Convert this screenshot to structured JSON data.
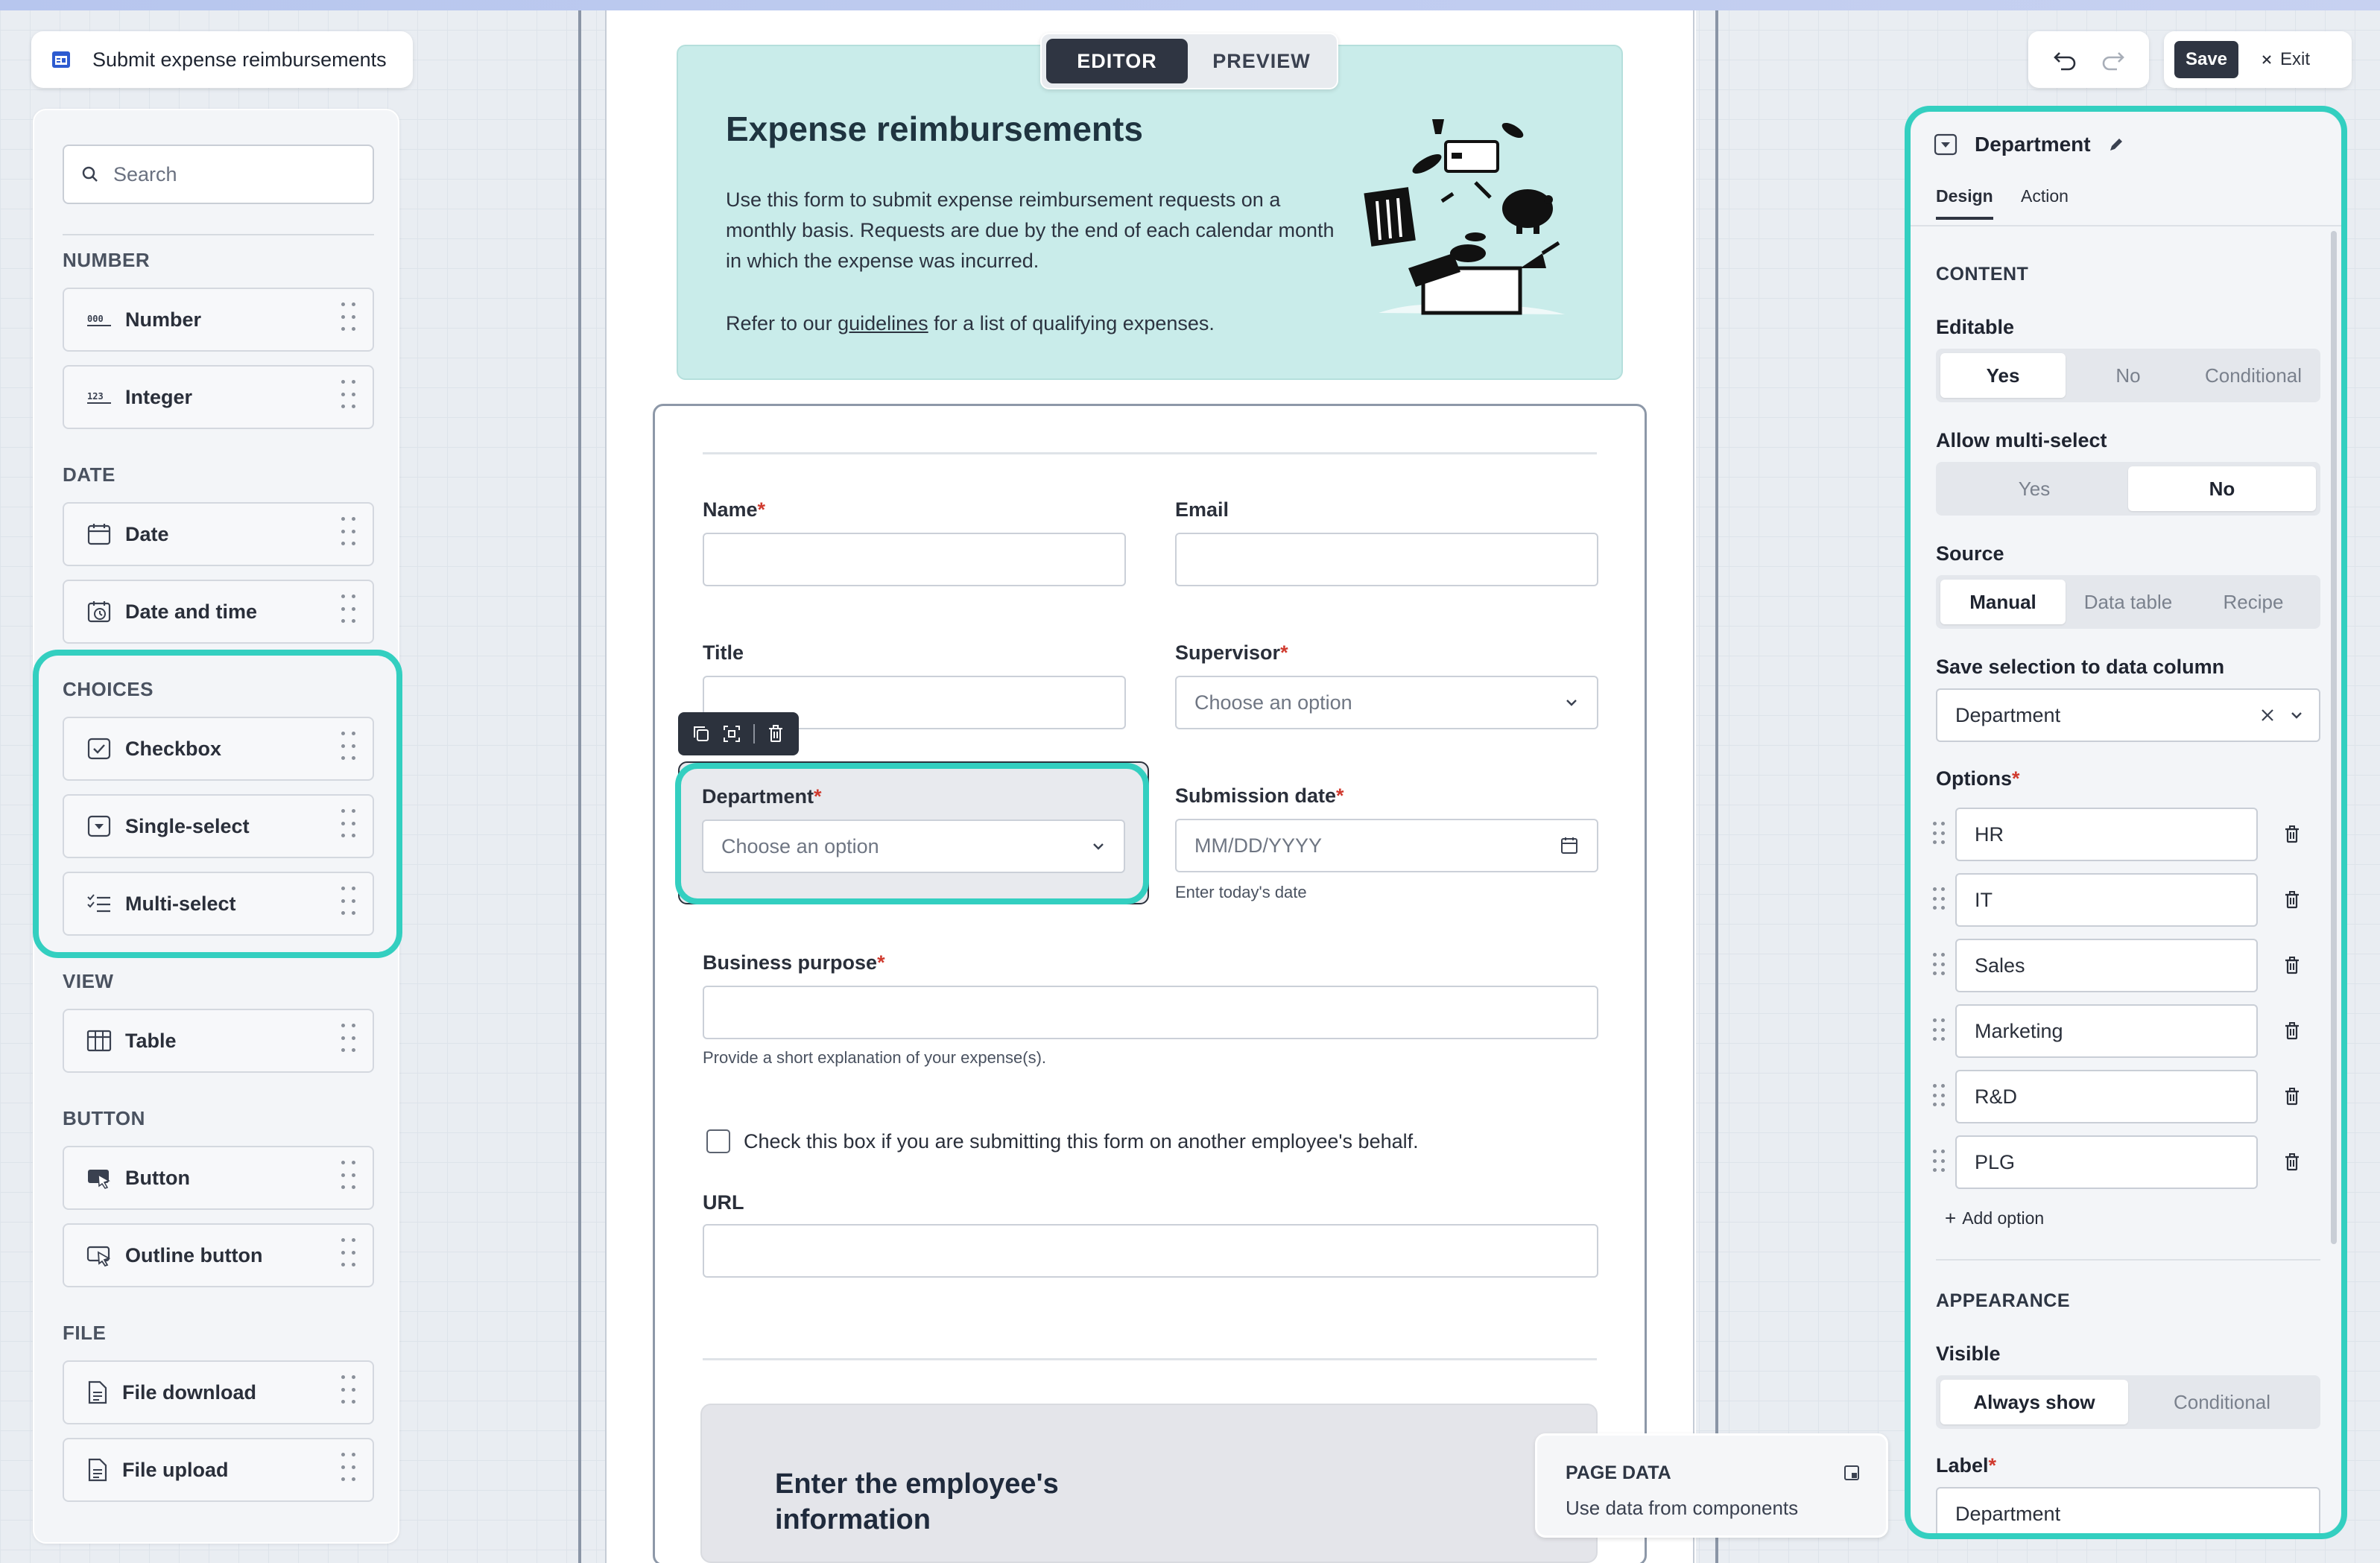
{
  "app": {
    "title": "Submit expense reimbursements"
  },
  "toolbar": {
    "save_label": "Save",
    "exit_label": "Exit"
  },
  "mode_tabs": [
    {
      "label": "EDITOR",
      "active": true
    },
    {
      "label": "PREVIEW",
      "active": false
    }
  ],
  "palette": {
    "search_placeholder": "Search",
    "sections": {
      "number": "NUMBER",
      "date": "DATE",
      "choices": "CHOICES",
      "view": "VIEW",
      "button": "BUTTON",
      "file": "FILE"
    },
    "items": {
      "number": "Number",
      "integer": "Integer",
      "date": "Date",
      "date_time": "Date and time",
      "checkbox": "Checkbox",
      "single_select": "Single-select",
      "multi_select": "Multi-select",
      "table": "Table",
      "button": "Button",
      "outline_button": "Outline button",
      "file_download": "File download",
      "file_upload": "File upload"
    }
  },
  "hero": {
    "title": "Expense reimbursements",
    "body": "Use this form to submit expense reimbursement requests on a monthly basis. Requests are due by the end of each calendar month in which the expense was incurred.",
    "refer_prefix": "Refer to our ",
    "refer_link": "guidelines",
    "refer_suffix": " for a list of qualifying expenses."
  },
  "form": {
    "name_label": "Name",
    "email_label": "Email",
    "title_label": "Title",
    "supervisor_label": "Supervisor",
    "supervisor_placeholder": "Choose an option",
    "department_label": "Department",
    "department_placeholder": "Choose an option",
    "submission_label": "Submission date",
    "submission_placeholder": "MM/DD/YYYY",
    "submission_hint": "Enter today's date",
    "purpose_label": "Business purpose",
    "purpose_hint": "Provide a short explanation of your expense(s).",
    "behalf_checkbox": "Check this box if you are submitting this form on another employee's behalf.",
    "url_label": "URL",
    "required_mark": "*",
    "section_heading": "Enter the employee's information"
  },
  "page_data_card": {
    "title": "PAGE DATA",
    "subtitle": "Use data from components"
  },
  "inspector": {
    "component_name": "Department",
    "tabs": [
      {
        "label": "Design",
        "active": true
      },
      {
        "label": "Action",
        "active": false
      }
    ],
    "content_heading": "CONTENT",
    "editable": {
      "label": "Editable",
      "options": [
        "Yes",
        "No",
        "Conditional"
      ],
      "selected": "Yes"
    },
    "multiselect": {
      "label": "Allow multi-select",
      "options": [
        "Yes",
        "No"
      ],
      "selected": "No"
    },
    "source": {
      "label": "Source",
      "options": [
        "Manual",
        "Data table",
        "Recipe"
      ],
      "selected": "Manual"
    },
    "save_column": {
      "label": "Save selection to data column",
      "value": "Department"
    },
    "options_label": "Options",
    "options": [
      "HR",
      "IT",
      "Sales",
      "Marketing",
      "R&D",
      "PLG"
    ],
    "add_option": "Add option",
    "appearance_heading": "APPEARANCE",
    "visible": {
      "label": "Visible",
      "options": [
        "Always show",
        "Conditional"
      ],
      "selected": "Always show"
    },
    "label_field": {
      "label": "Label",
      "value": "Department"
    }
  },
  "colors": {
    "highlight": "#33cfc0",
    "hero_bg": "#c9ecea",
    "required": "#d03a2e",
    "dark": "#2f3542"
  },
  "icons": [
    "app-icon",
    "search-icon",
    "number-icon",
    "integer-icon",
    "calendar-icon",
    "clock-calendar-icon",
    "checkbox-icon",
    "single-select-icon",
    "multi-select-icon",
    "table-icon",
    "button-icon",
    "outline-button-icon",
    "file-download-icon",
    "file-upload-icon",
    "undo-icon",
    "redo-icon",
    "close-icon",
    "chevron-down-icon",
    "copy-icon",
    "select-frame-icon",
    "trash-icon",
    "pencil-icon",
    "drag-handle-icon",
    "page-data-icon"
  ]
}
